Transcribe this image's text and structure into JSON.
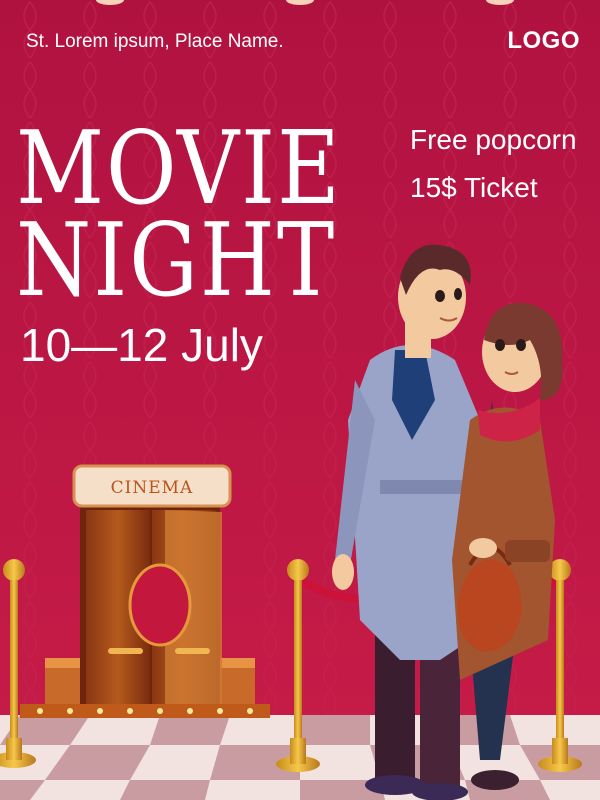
{
  "poster": {
    "address": "St. Lorem ipsum, Place Name.",
    "logo": "LOGO",
    "title_line_1": "MOVIE",
    "title_line_2": "NIGHT",
    "dates": "10—12 July",
    "perks": [
      "Free popcorn",
      "15$ Ticket"
    ],
    "cinema_sign": "CINEMA"
  },
  "colors": {
    "background": "#b3163f",
    "pattern": "#c0224d",
    "text": "#ffffff",
    "gold": "#f2b431",
    "floor_light": "#f4e7e4",
    "floor_dark": "#cfa7a9"
  }
}
